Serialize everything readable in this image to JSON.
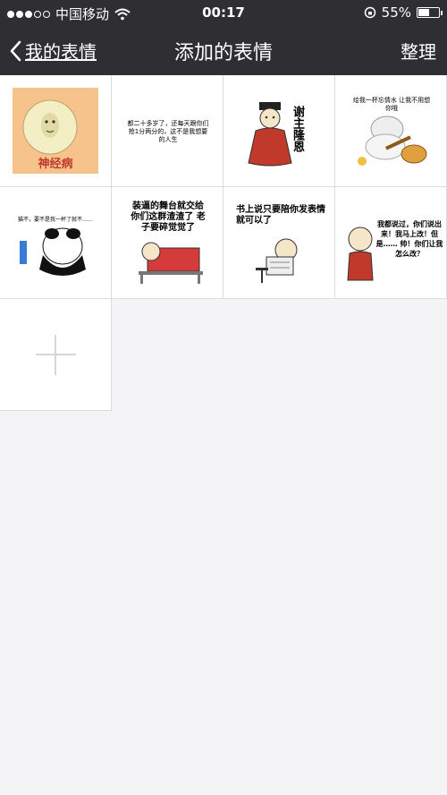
{
  "status": {
    "carrier": "中国移动",
    "time": "00:17",
    "battery": "55%",
    "battery_level": 0.55
  },
  "nav": {
    "back_label": "我的表情",
    "title": "添加的表情",
    "action": "整理"
  },
  "stickers": [
    {
      "caption": "神经病"
    },
    {
      "caption": "都二十多岁了，还每天跟你们抢1分两分的，这不是我想要的人生"
    },
    {
      "caption": "谢主隆恩"
    },
    {
      "caption": "给我一杯忘情水 让我不用想你哦"
    },
    {
      "caption": "猫不，要不是我一杯了就不……"
    },
    {
      "caption": "装逼的舞台就交给你们这群渣渣了 老子要碎觉觉了"
    },
    {
      "caption": "书上说只要陪你发表情就可以了"
    },
    {
      "caption": "我都说过，你们说出来！我马上改！但是…… 帅！你们让我怎么改？"
    }
  ],
  "colors": {
    "bar": "#2f2f33",
    "bg": "#f4f4f6",
    "sticker_red": "#c0392b",
    "sticker_orange": "#f7c38c"
  }
}
